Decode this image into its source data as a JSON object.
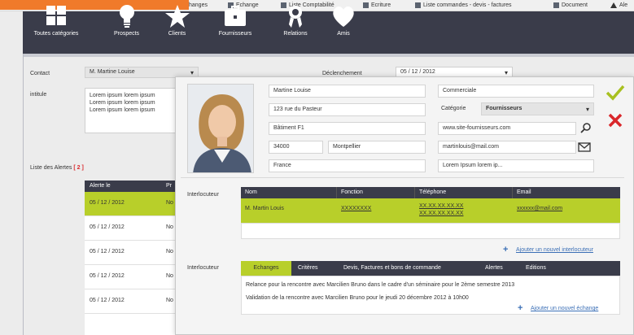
{
  "toolbar": {
    "items": [
      {
        "label": "hanges",
        "icon": "document-icon"
      },
      {
        "label": "Echange",
        "icon": "document-icon"
      },
      {
        "label": "Liste Comptabilité",
        "icon": "document-icon"
      },
      {
        "label": "Ecriture",
        "icon": "document-icon"
      },
      {
        "label": "Liste commandes - devis - factures",
        "icon": "document-icon"
      },
      {
        "label": "Document",
        "icon": "document-icon"
      },
      {
        "label": "Ale",
        "icon": "warning-icon"
      }
    ]
  },
  "nav": {
    "items": [
      {
        "label": "Toutes catégories",
        "icon": "grid-icon"
      },
      {
        "label": "Prospects",
        "icon": "lightbulb-icon"
      },
      {
        "label": "Clients",
        "icon": "star-icon"
      },
      {
        "label": "Fournisseurs",
        "icon": "briefcase-icon"
      },
      {
        "label": "Relations",
        "icon": "ribbon-icon"
      },
      {
        "label": "Amis",
        "icon": "heart-icon"
      }
    ]
  },
  "form": {
    "contact_label": "Contact",
    "contact_value": "M. Martine Louise",
    "declenchement_label": "Déclenchement",
    "declenchement_value": "05 / 12 / 2012",
    "intitule_label": "intitule",
    "intitule_lines": [
      "Lorem ipsum lorem ipsum",
      "Lorem ipsum lorem ipsum",
      "Lorem ipsum lorem ipsum"
    ],
    "alerts_label": "Liste des Alertes",
    "alerts_count": "[ 2 ]"
  },
  "alerts_table": {
    "headers": [
      "Alerte le",
      "Pr"
    ],
    "rows": [
      {
        "date": "05 / 12 / 2012",
        "col2": "No"
      },
      {
        "date": "05 / 12 / 2012",
        "col2": "No"
      },
      {
        "date": "05 / 12 / 2012",
        "col2": "No"
      },
      {
        "date": "05 / 12 / 2012",
        "col2": "No"
      },
      {
        "date": "05 / 12 / 2012",
        "col2": "No"
      }
    ]
  },
  "contact_card": {
    "name": "Martine Louise",
    "address": "123 rue du Pasteur",
    "building": "Bâtiment F1",
    "postal_code": "34000",
    "city": "Montpellier",
    "country": "France",
    "role": "Commerciale",
    "category_label": "Catégorie",
    "category_value": "Fournisseurs",
    "website": "www.site-fournisseurs.com",
    "email": "martinlouis@mail.com",
    "note": "Lorem Ipsum lorem ip..."
  },
  "interlocuteurs": {
    "section_label": "Interlocuteur",
    "headers": [
      "Nom",
      "Fonction",
      "Téléphone",
      "Email"
    ],
    "rows": [
      {
        "nom": "M. Martin Louis",
        "fonction": "XXXXXXXX",
        "tel1": "XX.XX.XX.XX.XX",
        "tel2": "XX.XX.XX.XX.XX",
        "email": "xxxxxx@mail.com"
      }
    ],
    "add_link": "Ajouter un nouvel interlocuteur"
  },
  "exchanges": {
    "section_label": "Interlocuteur",
    "tabs": [
      "Echanges",
      "Critères",
      "Devis, Factures et bons de commande",
      "Alertes",
      "Editions"
    ],
    "lines": [
      "Relance pour la rencontre avec Marcilien Bruno dans le cadre d'un séminaire pour le 2ème semestre 2013",
      "Validation de la rencontre avec Marcilien Bruno pour le jeudi 20 décembre 2012 à 10h00"
    ],
    "add_link": "Ajouter un nouvel échange"
  },
  "colors": {
    "accent_green": "#b8cf2a",
    "nav_dark": "#3a3c4a",
    "orange": "#f07a2a",
    "cancel_red": "#d9262a",
    "link_blue": "#3b6fb6"
  }
}
